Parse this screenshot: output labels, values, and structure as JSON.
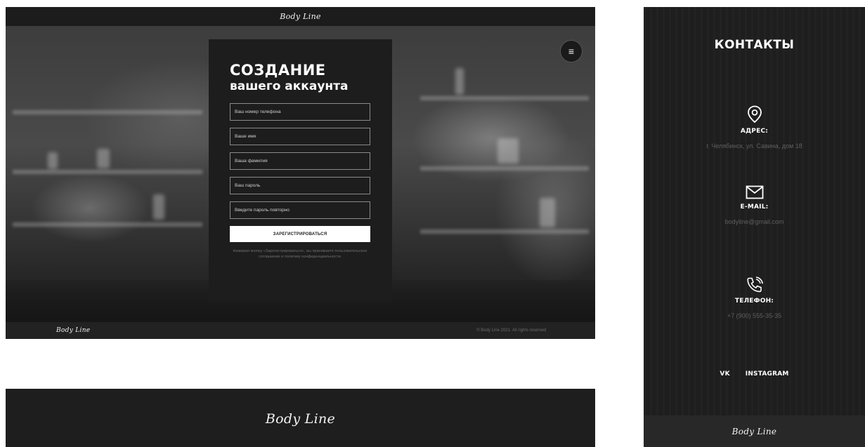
{
  "brand": {
    "logo_text": "Body Line"
  },
  "registration": {
    "title": "СОЗДАНИЕ",
    "subtitle": "вашего аккаунта",
    "fields": {
      "phone": "Ваш номер телефона",
      "first_name": "Ваше имя",
      "last_name": "Ваша фамилия",
      "password": "Ваш пароль",
      "password_repeat": "Введите пароль повторно"
    },
    "submit_label": "ЗАРЕГИСТРИРОВАТЬСЯ",
    "agreement_note": "Нажимая кнопку «Зарегистрироваться», вы принимаете пользовательское соглашение и политику конфиденциальности.",
    "menu_icon": "hamburger-icon"
  },
  "footer": {
    "copyright": "© Body Line 2021. All rights reserved"
  },
  "contacts": {
    "title": "КОНТАКТЫ",
    "address": {
      "icon": "location-pin-icon",
      "label": "АДРЕС:",
      "value": "г. Челябинск, ул. Савина, дом 18"
    },
    "email": {
      "icon": "envelope-icon",
      "label": "E-MAIL:",
      "value": "bodyline@gmail.com"
    },
    "phone": {
      "icon": "phone-icon",
      "label": "ТЕЛЕФОН:",
      "value": "+7 (900) 555-35-35"
    },
    "socials": [
      "VK",
      "INSTAGRAM"
    ]
  },
  "colors": {
    "background": "#1e1e1e",
    "accent": "#ffffff",
    "muted": "#6b6b6b"
  }
}
